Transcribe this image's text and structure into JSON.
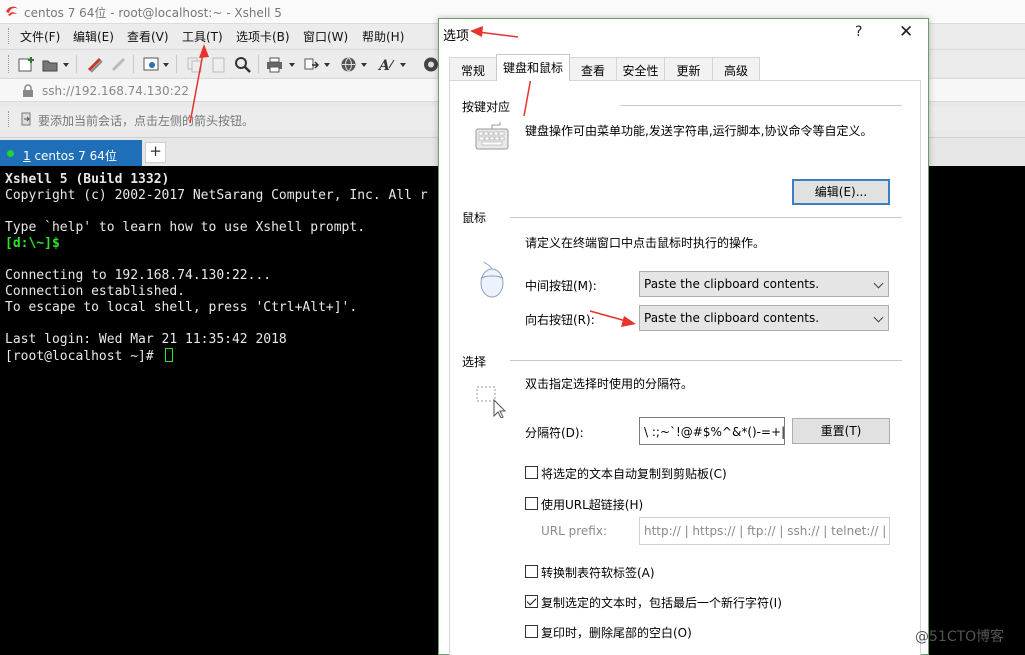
{
  "window": {
    "title": "centos 7 64位 - root@localhost:~ - Xshell 5"
  },
  "menu": [
    "文件(F)",
    "编辑(E)",
    "查看(V)",
    "工具(T)",
    "选项卡(B)",
    "窗口(W)",
    "帮助(H)"
  ],
  "address": {
    "url": "ssh://192.168.74.130:22"
  },
  "session_bar": {
    "hint": "要添加当前会话，点击左侧的箭头按钮。"
  },
  "session_tab": {
    "number": "1",
    "label": " centos 7 64位"
  },
  "new_tab_label": "+",
  "terminal": {
    "lines": [
      "Xshell 5 (Build 1332)",
      "Copyright (c) 2002-2017 NetSarang Computer, Inc. All r",
      "",
      "Type `help' to learn how to use Xshell prompt.",
      "[d:\\~]$",
      "",
      "Connecting to 192.168.74.130:22...",
      "Connection established.",
      "To escape to local shell, press 'Ctrl+Alt+]'.",
      "",
      "Last login: Wed Mar 21 11:35:42 2018",
      "[root@localhost ~]# "
    ]
  },
  "dialog": {
    "title": "选项",
    "help": "?",
    "close": "✕",
    "tabs": [
      "常规",
      "键盘和鼠标",
      "查看",
      "安全性",
      "更新",
      "高级"
    ],
    "active_tab": "键盘和鼠标",
    "keyboard": {
      "title": "按键对应",
      "description": "键盘操作可由菜单功能,发送字符串,运行脚本,协议命令等自定义。",
      "edit_button": "编辑(E)..."
    },
    "mouse": {
      "title": "鼠标",
      "description": "请定义在终端窗口中点击鼠标时执行的操作。",
      "middle_label": "中间按钮(M):",
      "middle_value": "Paste the clipboard contents.",
      "right_label": "向右按钮(R):",
      "right_value": "Paste the clipboard contents."
    },
    "selection": {
      "title": "选择",
      "description": "双击指定选择时使用的分隔符。",
      "delimiter_label": "分隔符(D):",
      "delimiter_value": "\\ :;~`!@#$%^&*()-=+|[]{",
      "reset_button": "重置(T)",
      "options": [
        {
          "label": "将选定的文本自动复制到剪贴板(C)",
          "checked": false
        },
        {
          "label": "使用URL超链接(H)",
          "checked": false
        },
        {
          "label": "转换制表符软标签(A)",
          "checked": false
        },
        {
          "label": "复制选定的文本时，包括最后一个新行字符(I)",
          "checked": true
        },
        {
          "label": "复印时，删除尾部的空白(O)",
          "checked": false
        }
      ],
      "url_prefix_label": "URL prefix:",
      "url_prefix_value": "http:// | https:// | ftp:// | ssh:// | telnet:// |"
    }
  },
  "watermark": "@51CTO博客",
  "colors": {
    "tab_blue": "#1e6fb8",
    "term_green": "#2ee32e",
    "arrow_red": "#e8322b"
  }
}
